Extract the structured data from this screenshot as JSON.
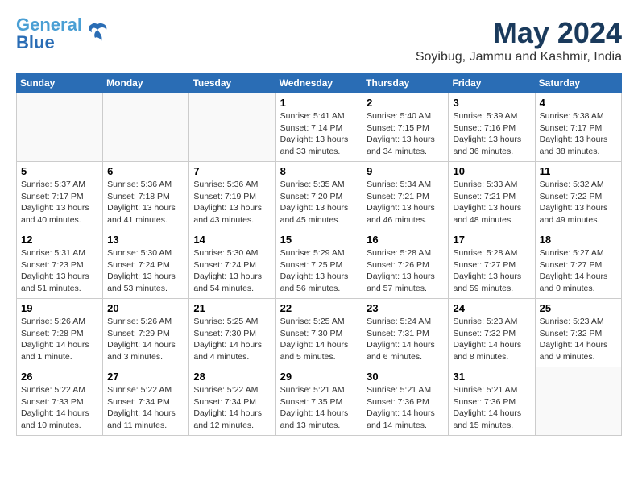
{
  "header": {
    "logo_line1": "General",
    "logo_line2": "Blue",
    "month": "May 2024",
    "location": "Soyibug, Jammu and Kashmir, India"
  },
  "weekdays": [
    "Sunday",
    "Monday",
    "Tuesday",
    "Wednesday",
    "Thursday",
    "Friday",
    "Saturday"
  ],
  "weeks": [
    [
      {
        "day": "",
        "info": ""
      },
      {
        "day": "",
        "info": ""
      },
      {
        "day": "",
        "info": ""
      },
      {
        "day": "1",
        "info": "Sunrise: 5:41 AM\nSunset: 7:14 PM\nDaylight: 13 hours\nand 33 minutes."
      },
      {
        "day": "2",
        "info": "Sunrise: 5:40 AM\nSunset: 7:15 PM\nDaylight: 13 hours\nand 34 minutes."
      },
      {
        "day": "3",
        "info": "Sunrise: 5:39 AM\nSunset: 7:16 PM\nDaylight: 13 hours\nand 36 minutes."
      },
      {
        "day": "4",
        "info": "Sunrise: 5:38 AM\nSunset: 7:17 PM\nDaylight: 13 hours\nand 38 minutes."
      }
    ],
    [
      {
        "day": "5",
        "info": "Sunrise: 5:37 AM\nSunset: 7:17 PM\nDaylight: 13 hours\nand 40 minutes."
      },
      {
        "day": "6",
        "info": "Sunrise: 5:36 AM\nSunset: 7:18 PM\nDaylight: 13 hours\nand 41 minutes."
      },
      {
        "day": "7",
        "info": "Sunrise: 5:36 AM\nSunset: 7:19 PM\nDaylight: 13 hours\nand 43 minutes."
      },
      {
        "day": "8",
        "info": "Sunrise: 5:35 AM\nSunset: 7:20 PM\nDaylight: 13 hours\nand 45 minutes."
      },
      {
        "day": "9",
        "info": "Sunrise: 5:34 AM\nSunset: 7:21 PM\nDaylight: 13 hours\nand 46 minutes."
      },
      {
        "day": "10",
        "info": "Sunrise: 5:33 AM\nSunset: 7:21 PM\nDaylight: 13 hours\nand 48 minutes."
      },
      {
        "day": "11",
        "info": "Sunrise: 5:32 AM\nSunset: 7:22 PM\nDaylight: 13 hours\nand 49 minutes."
      }
    ],
    [
      {
        "day": "12",
        "info": "Sunrise: 5:31 AM\nSunset: 7:23 PM\nDaylight: 13 hours\nand 51 minutes."
      },
      {
        "day": "13",
        "info": "Sunrise: 5:30 AM\nSunset: 7:24 PM\nDaylight: 13 hours\nand 53 minutes."
      },
      {
        "day": "14",
        "info": "Sunrise: 5:30 AM\nSunset: 7:24 PM\nDaylight: 13 hours\nand 54 minutes."
      },
      {
        "day": "15",
        "info": "Sunrise: 5:29 AM\nSunset: 7:25 PM\nDaylight: 13 hours\nand 56 minutes."
      },
      {
        "day": "16",
        "info": "Sunrise: 5:28 AM\nSunset: 7:26 PM\nDaylight: 13 hours\nand 57 minutes."
      },
      {
        "day": "17",
        "info": "Sunrise: 5:28 AM\nSunset: 7:27 PM\nDaylight: 13 hours\nand 59 minutes."
      },
      {
        "day": "18",
        "info": "Sunrise: 5:27 AM\nSunset: 7:27 PM\nDaylight: 14 hours\nand 0 minutes."
      }
    ],
    [
      {
        "day": "19",
        "info": "Sunrise: 5:26 AM\nSunset: 7:28 PM\nDaylight: 14 hours\nand 1 minute."
      },
      {
        "day": "20",
        "info": "Sunrise: 5:26 AM\nSunset: 7:29 PM\nDaylight: 14 hours\nand 3 minutes."
      },
      {
        "day": "21",
        "info": "Sunrise: 5:25 AM\nSunset: 7:30 PM\nDaylight: 14 hours\nand 4 minutes."
      },
      {
        "day": "22",
        "info": "Sunrise: 5:25 AM\nSunset: 7:30 PM\nDaylight: 14 hours\nand 5 minutes."
      },
      {
        "day": "23",
        "info": "Sunrise: 5:24 AM\nSunset: 7:31 PM\nDaylight: 14 hours\nand 6 minutes."
      },
      {
        "day": "24",
        "info": "Sunrise: 5:23 AM\nSunset: 7:32 PM\nDaylight: 14 hours\nand 8 minutes."
      },
      {
        "day": "25",
        "info": "Sunrise: 5:23 AM\nSunset: 7:32 PM\nDaylight: 14 hours\nand 9 minutes."
      }
    ],
    [
      {
        "day": "26",
        "info": "Sunrise: 5:22 AM\nSunset: 7:33 PM\nDaylight: 14 hours\nand 10 minutes."
      },
      {
        "day": "27",
        "info": "Sunrise: 5:22 AM\nSunset: 7:34 PM\nDaylight: 14 hours\nand 11 minutes."
      },
      {
        "day": "28",
        "info": "Sunrise: 5:22 AM\nSunset: 7:34 PM\nDaylight: 14 hours\nand 12 minutes."
      },
      {
        "day": "29",
        "info": "Sunrise: 5:21 AM\nSunset: 7:35 PM\nDaylight: 14 hours\nand 13 minutes."
      },
      {
        "day": "30",
        "info": "Sunrise: 5:21 AM\nSunset: 7:36 PM\nDaylight: 14 hours\nand 14 minutes."
      },
      {
        "day": "31",
        "info": "Sunrise: 5:21 AM\nSunset: 7:36 PM\nDaylight: 14 hours\nand 15 minutes."
      },
      {
        "day": "",
        "info": ""
      }
    ]
  ]
}
